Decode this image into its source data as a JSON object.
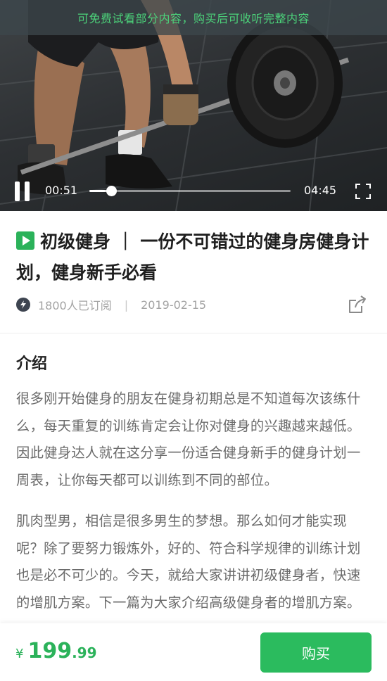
{
  "video": {
    "trial_notice": "可免费试看部分内容，购买后可收听完整内容",
    "current_time": "00:51",
    "total_time": "04:45",
    "progress_fraction": 0.11,
    "pause_icon": "pause-icon",
    "fullscreen_icon": "fullscreen-icon"
  },
  "course": {
    "type_icon": "video-play-badge-icon",
    "title": "初级健身 ｜ 一份不可错过的健身房健身计划，健身新手必看",
    "subscribers": "1800人已订阅",
    "separator": "|",
    "date": "2019-02-15",
    "share_icon": "share-icon"
  },
  "intro": {
    "heading": "介绍",
    "paragraphs": [
      "很多刚开始健身的朋友在健身初期总是不知道每次该练什么，每天重复的训练肯定会让你对健身的兴趣越来越低。因此健身达人就在这分享一份适合健身新手的健身计划一周表，让你每天都可以训练到不同的部位。",
      "肌肉型男，相信是很多男生的梦想。那么如何才能实现呢？除了要努力锻炼外，好的、符合科学规律的训练计划也是必不可少的。今天，就给大家讲讲初级健身者，快速的增肌方案。下一篇为大家介绍高级健身者的增肌方案。"
    ]
  },
  "purchase": {
    "currency": "¥",
    "price_integer": "199",
    "price_decimal": ".99",
    "buy_label": "购买"
  },
  "colors": {
    "accent": "#2bb25a",
    "trial_text": "#4cd27a",
    "body_text": "#6b6b6b",
    "meta_text": "#a3a3a3"
  }
}
